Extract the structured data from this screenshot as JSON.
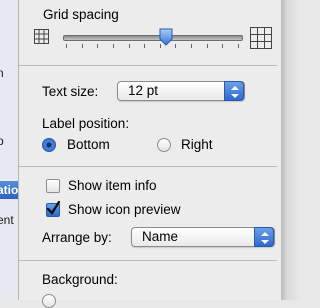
{
  "sidebar": {
    "fragments": [
      "n",
      "p",
      "atio",
      "ent"
    ],
    "selected_index": 2,
    "selection_color": "#2c62c0"
  },
  "grid_spacing": {
    "label": "Grid spacing",
    "slider_value_fraction": 0.58,
    "small_icon": "small-grid-icon",
    "large_icon": "large-grid-icon"
  },
  "text_size": {
    "label": "Text size:",
    "value": "12 pt"
  },
  "label_position": {
    "label": "Label position:",
    "options": [
      "Bottom",
      "Right"
    ],
    "selected": "Bottom"
  },
  "show_item_info": {
    "label": "Show item info",
    "checked": false
  },
  "show_icon_preview": {
    "label": "Show icon preview",
    "checked": true
  },
  "arrange_by": {
    "label": "Arrange by:",
    "value": "Name"
  },
  "background": {
    "label": "Background:"
  },
  "colors": {
    "accent": "#2f68cf",
    "panel": "#ececec"
  }
}
